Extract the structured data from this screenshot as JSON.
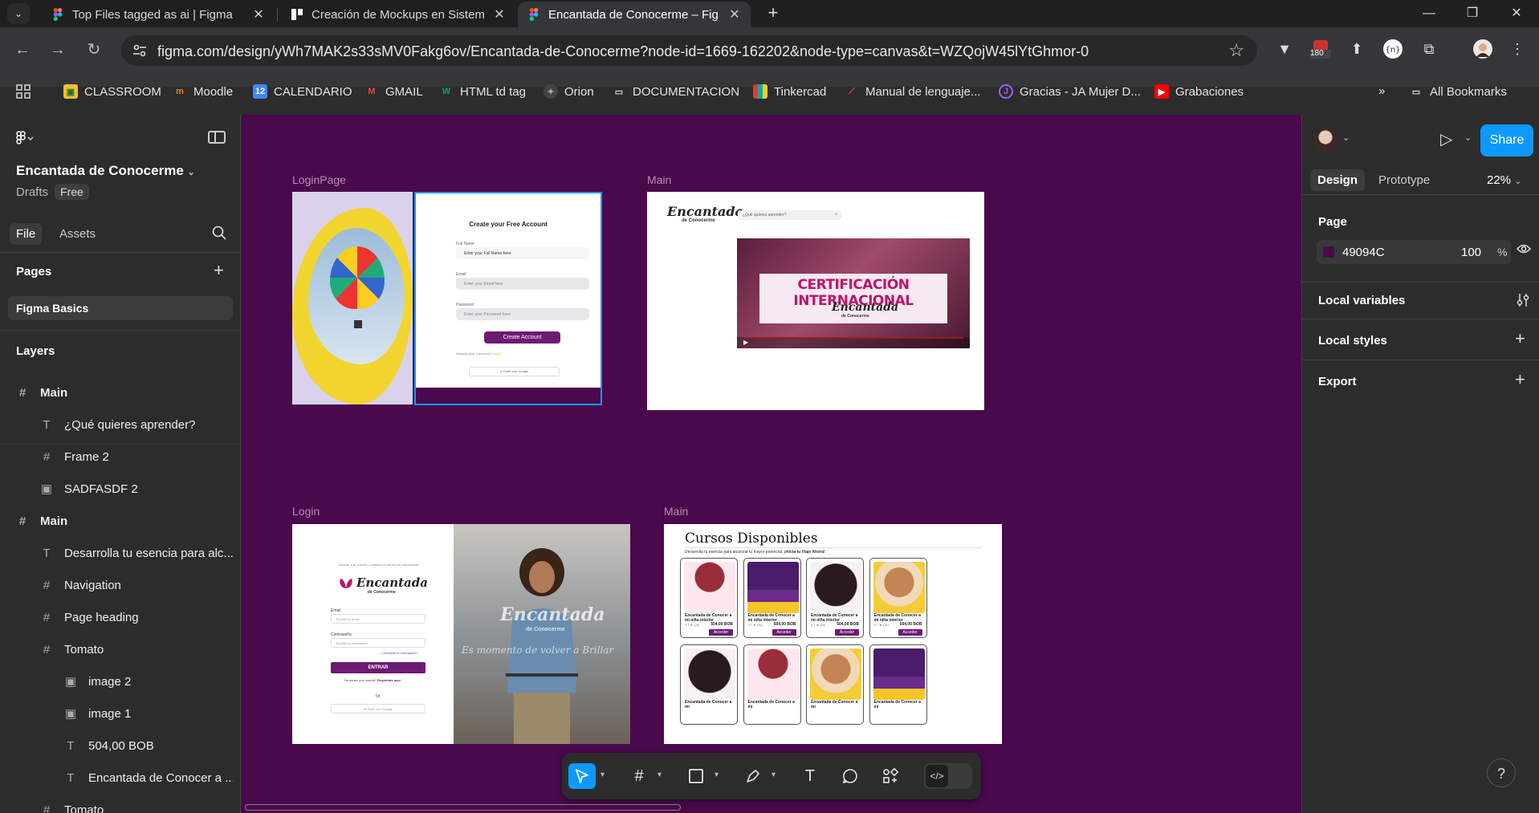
{
  "browser": {
    "tabs": [
      {
        "title": "Top Files tagged as ai | Figma",
        "active": false
      },
      {
        "title": "Creación de Mockups en Sistem",
        "active": false
      },
      {
        "title": "Encantada de Conocerme – Fig",
        "active": true
      }
    ],
    "url": "figma.com/design/yWh7MAK2s33sMV0Fakg6ov/Encantada-de-Conocerme?node-id=1669-162202&node-type=canvas&t=WZQojW45lYtGhmor-0",
    "extension_badge": "180",
    "bookmarks": [
      "CLASSROOM",
      "Moodle",
      "CALENDARIO",
      "GMAIL",
      "HTML td tag",
      "Orion",
      "DOCUMENTACION",
      "Tinkercad",
      "Manual de lenguaje...",
      "Gracias - JA Mujer D...",
      "Grabaciones"
    ],
    "all_bookmarks": "All Bookmarks"
  },
  "left_panel": {
    "file_title": "Encantada de Conocerme",
    "drafts": "Drafts",
    "plan_badge": "Free",
    "tabs": {
      "file": "File",
      "assets": "Assets"
    },
    "pages_label": "Pages",
    "current_page": "Figma Basics",
    "layers_label": "Layers",
    "layers": [
      {
        "name": "Main",
        "type": "frame",
        "indent": 0
      },
      {
        "name": "¿Qué quieres aprender?",
        "type": "text",
        "indent": 1
      },
      {
        "name": "Frame 2",
        "type": "frame",
        "indent": 1
      },
      {
        "name": "SADFASDF 2",
        "type": "image",
        "indent": 1
      },
      {
        "name": "Main",
        "type": "frame",
        "indent": 0
      },
      {
        "name": "Desarrolla tu esencia para alc...",
        "type": "text",
        "indent": 1
      },
      {
        "name": "Navigation",
        "type": "frame",
        "indent": 1
      },
      {
        "name": "Page heading",
        "type": "frame",
        "indent": 1
      },
      {
        "name": "Tomato",
        "type": "frame",
        "indent": 1
      },
      {
        "name": "image 2",
        "type": "image",
        "indent": 2
      },
      {
        "name": "image 1",
        "type": "image",
        "indent": 2
      },
      {
        "name": "504,00 BOB",
        "type": "text",
        "indent": 2
      },
      {
        "name": "Encantada de Conocer a ...",
        "type": "text",
        "indent": 2
      },
      {
        "name": "Tomato",
        "type": "frame",
        "indent": 1
      }
    ]
  },
  "canvas": {
    "background": "#49094c",
    "frames": {
      "loginpage": {
        "label": "LoginPage",
        "title": "Create your Free Account",
        "full_name_label": "Full Name",
        "full_name_placeholder": "Enter your Full Name here",
        "email_label": "Email",
        "email_placeholder": "Enter your Email here",
        "password_label": "Password",
        "password_placeholder": "Enter your Password here",
        "create_button": "Create Account",
        "already_text": "Already have a account?",
        "login_link": "Log in",
        "google_button": "Enter con Google"
      },
      "main1": {
        "label": "Main",
        "logo": "Encantada",
        "logo_sub": "de Conocerme",
        "search_placeholder": "¿Qué quieres aprender?",
        "video_headline": "CERTIFICACIÓN INTERNACIONAL",
        "video_brand": "Encantada",
        "video_brand_sub": "de Conocerme"
      },
      "login": {
        "label": "Login",
        "tagline": "Accede a tu cuenta y continúa tu camino de crecimiento.",
        "logo": "Encantada",
        "logo_sub": "de Conocerme",
        "email_label": "Email",
        "email_placeholder": "Escribe tu email",
        "password_label": "Contraseña",
        "password_placeholder": "Escribe tu contraseña",
        "forgot": "¿Olvidaste tu contraseña?",
        "enter_button": "ENTRAR",
        "register_text": "No tienes una cuenta?",
        "register_link": "Regístrate aquí",
        "or": "Or",
        "google_button": "Enter con Google",
        "photo_overlay": "Encantada",
        "photo_overlay_sub": "de Conocerme",
        "photo_tagline": "Es momento de volver a Brillar"
      },
      "main2": {
        "label": "Main",
        "title": "Cursos Disponibles",
        "subtitle": "Desarrolla tu esencia para alcanzar tu mayor potencial.",
        "subtitle_strong": "¡Inicia tu Viaje Ahora!",
        "cards": [
          {
            "style": "pink",
            "title": "Encantada de Conocer a mi niña interior",
            "price": "504,00 BOB",
            "rating": "4.7 ★ (2k)",
            "button": "Acceder"
          },
          {
            "style": "cert",
            "title": "Encantada de Conocer a mi niña interior",
            "price": "504,00 BOB",
            "rating": "4.7 ★ (2k)",
            "button": "Acceder"
          },
          {
            "style": "comm",
            "title": "Encantada de Conocer a mi niña interior",
            "price": "504,00 BOB",
            "rating": "4.7 ★ (2k)",
            "button": "Acceder"
          },
          {
            "style": "curso",
            "title": "Encantada de Conocer a mi niña interior",
            "price": "504,00 BOB",
            "rating": "4.7 ★ (2k)",
            "button": "Acceder"
          },
          {
            "style": "comm",
            "title": "Encantada de Conocer a mi",
            "price": "",
            "rating": "",
            "button": ""
          },
          {
            "style": "pink",
            "title": "Encantada de Conocer a mi",
            "price": "",
            "rating": "",
            "button": ""
          },
          {
            "style": "curso",
            "title": "Encantada de Conocer a mi",
            "price": "",
            "rating": "",
            "button": ""
          },
          {
            "style": "cert",
            "title": "Encantada de Conocer a mi",
            "price": "",
            "rating": "",
            "button": ""
          }
        ]
      }
    }
  },
  "right_panel": {
    "share": "Share",
    "tabs": {
      "design": "Design",
      "prototype": "Prototype"
    },
    "zoom": "22%",
    "page_label": "Page",
    "page_color": "49094C",
    "page_color_hex": "#49094c",
    "opacity": "100",
    "opacity_unit": "%",
    "local_variables": "Local variables",
    "local_styles": "Local styles",
    "export": "Export"
  },
  "help": "?"
}
